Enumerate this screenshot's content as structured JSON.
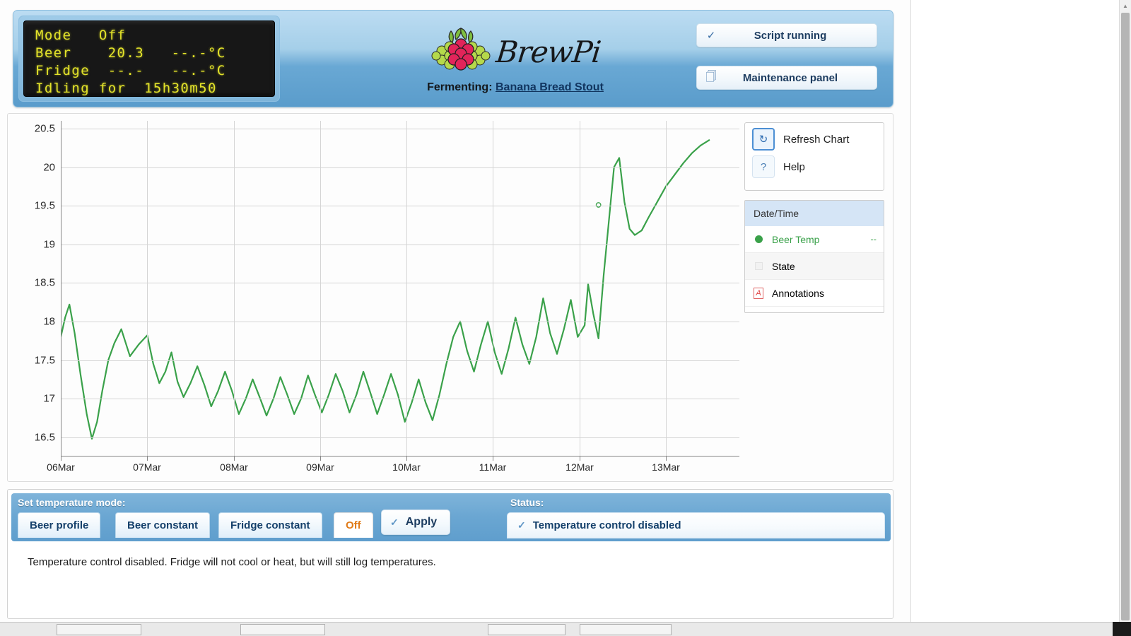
{
  "lcd": {
    "lines": [
      "Mode   Off",
      "Beer    20.3   --.-°C",
      "Fridge  --.-   --.-°C",
      "Idling for  15h30m50"
    ]
  },
  "header": {
    "logo_word": "BrewPi",
    "logo_icon": "raspberry-logo",
    "fermenting_label": "Fermenting:",
    "beer_name": "Banana Bread Stout",
    "script_button": {
      "label": "Script running",
      "icon": "check-icon"
    },
    "maintenance_button": {
      "label": "Maintenance panel",
      "icon": "window-icon"
    }
  },
  "chart_tools": {
    "refresh": {
      "label": "Refresh Chart",
      "icon": "refresh-icon",
      "glyph": "↻"
    },
    "help": {
      "label": "Help",
      "icon": "help-icon",
      "glyph": "?"
    }
  },
  "legend": {
    "header": "Date/Time",
    "rows": [
      {
        "name": "Beer Temp",
        "value": "--",
        "swatch": "green-dot",
        "color": "#3aa14a"
      },
      {
        "name": "State",
        "value": "",
        "swatch": "grey-square",
        "color": "#f2f2f2"
      },
      {
        "name": "Annotations",
        "value": "",
        "swatch": "annotation-box",
        "color": "#e04141"
      }
    ]
  },
  "controls": {
    "mode_caption": "Set temperature mode:",
    "status_caption": "Status:",
    "tabs": [
      {
        "label": "Beer profile",
        "active": false
      },
      {
        "label": "Beer constant",
        "active": false
      },
      {
        "label": "Fridge constant",
        "active": false
      },
      {
        "label": "Off",
        "active": true
      }
    ],
    "apply_label": "Apply",
    "apply_icon": "check-icon",
    "status_text": "Temperature control disabled",
    "status_icon": "check-icon",
    "description": "Temperature control disabled. Fridge will not cool or heat, but will still log temperatures."
  },
  "chart_data": {
    "type": "line",
    "title": "",
    "xlabel": "",
    "ylabel": "",
    "ylim": [
      16.25,
      20.6
    ],
    "yticks": [
      16.5,
      17,
      17.5,
      18,
      18.5,
      19,
      19.5,
      20,
      20.5
    ],
    "xticks": [
      "06Mar",
      "07Mar",
      "08Mar",
      "09Mar",
      "10Mar",
      "11Mar",
      "12Mar",
      "13Mar"
    ],
    "grid": true,
    "legend_position": "right",
    "series": [
      {
        "name": "Beer Temp",
        "color": "#3aa14a",
        "x": [
          0.0,
          0.05,
          0.1,
          0.16,
          0.23,
          0.3,
          0.36,
          0.42,
          0.48,
          0.55,
          0.62,
          0.7,
          0.8,
          0.9,
          1.0,
          1.07,
          1.14,
          1.21,
          1.28,
          1.35,
          1.42,
          1.5,
          1.58,
          1.66,
          1.74,
          1.82,
          1.9,
          1.98,
          2.06,
          2.14,
          2.22,
          2.3,
          2.38,
          2.46,
          2.54,
          2.62,
          2.7,
          2.78,
          2.86,
          2.94,
          3.02,
          3.1,
          3.18,
          3.26,
          3.34,
          3.42,
          3.5,
          3.58,
          3.66,
          3.74,
          3.82,
          3.9,
          3.98,
          4.06,
          4.14,
          4.22,
          4.3,
          4.38,
          4.46,
          4.54,
          4.62,
          4.7,
          4.78,
          4.86,
          4.94,
          5.02,
          5.1,
          5.18,
          5.26,
          5.34,
          5.42,
          5.5,
          5.58,
          5.66,
          5.74,
          5.82,
          5.9,
          5.98,
          6.06,
          6.1,
          6.16,
          6.22,
          6.28,
          6.34,
          6.4,
          6.46,
          6.52,
          6.58,
          6.64,
          6.72,
          6.8,
          6.9,
          7.0,
          7.1,
          7.2,
          7.3,
          7.4,
          7.5
        ],
        "y": [
          17.8,
          18.05,
          18.22,
          17.85,
          17.3,
          16.8,
          16.48,
          16.7,
          17.1,
          17.5,
          17.72,
          17.9,
          17.55,
          17.7,
          17.82,
          17.45,
          17.2,
          17.35,
          17.6,
          17.22,
          17.02,
          17.2,
          17.42,
          17.18,
          16.9,
          17.1,
          17.35,
          17.1,
          16.8,
          17.0,
          17.25,
          17.02,
          16.78,
          17.0,
          17.28,
          17.05,
          16.8,
          17.0,
          17.3,
          17.05,
          16.82,
          17.05,
          17.32,
          17.1,
          16.82,
          17.05,
          17.35,
          17.08,
          16.8,
          17.05,
          17.32,
          17.05,
          16.7,
          16.95,
          17.25,
          16.95,
          16.72,
          17.05,
          17.45,
          17.8,
          18.0,
          17.62,
          17.35,
          17.7,
          18.0,
          17.6,
          17.32,
          17.65,
          18.05,
          17.7,
          17.45,
          17.8,
          18.3,
          17.85,
          17.58,
          17.9,
          18.28,
          17.8,
          17.95,
          18.48,
          18.1,
          17.78,
          18.6,
          19.3,
          20.0,
          20.12,
          19.55,
          19.2,
          19.12,
          19.18,
          19.35,
          19.55,
          19.75,
          19.9,
          20.05,
          20.18,
          20.28,
          20.35
        ]
      }
    ],
    "markers": [
      {
        "x": 6.22,
        "y": 19.51,
        "type": "open-circle"
      }
    ]
  }
}
